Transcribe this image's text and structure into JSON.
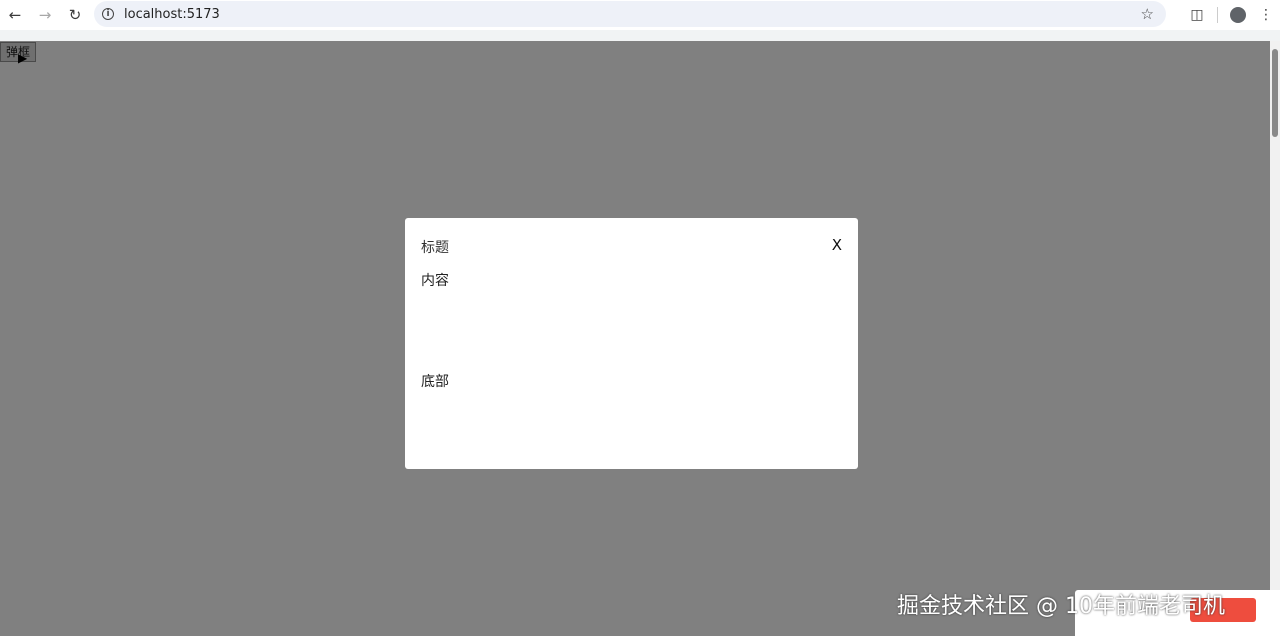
{
  "browser": {
    "url": "localhost:5173"
  },
  "page": {
    "popup_button_label": "弹框"
  },
  "modal": {
    "title": "标题",
    "close_label": "X",
    "content": "内容",
    "footer": "底部"
  },
  "watermark": {
    "text": "掘金技术社区 @ 10年前端老司机"
  },
  "colors": {
    "overlay": "#808080",
    "modal_bg": "#ffffff",
    "promo_button": "#ee4d3e"
  }
}
